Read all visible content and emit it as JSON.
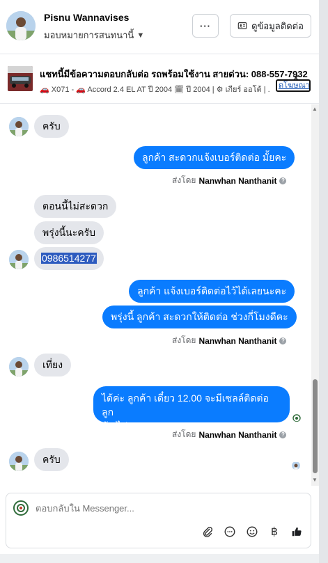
{
  "header": {
    "user_name": "Pisnu Wannavises",
    "assignee": "มอบหมายการสนทนานี้",
    "more_label": "···",
    "contact_label": "ดูข้อมูลติดต่อ"
  },
  "ad": {
    "title": "แชทนี้มีข้อความตอบกลับต่อ รถพร้อมใช้งาน สายด่วน: 088-557-7932",
    "meta": "🚗 X071 - 🚗 Accord 2.4 EL AT ปี 2004 🗓 ปี 2004 | ⚙ เกียร์ ออโต้ | ...",
    "link_label": "ดโฆษณา",
    "close_label": "✕"
  },
  "messages": {
    "m1": "ครับ",
    "m2": "ลูกค้า สะดวกแจ้งเบอร์ติดต่อ มั้ยคะ",
    "m3": "ตอนนี้ไม่สะดวก",
    "m4": "พรุ่งนี้นะครับ",
    "m5": "0986514277",
    "m6": "ลูกค้า แจ้งเบอร์ติดต่อไว้ได้เลยนะคะ",
    "m7": "พรุ่งนี้ ลูกค้า สะดวกให้ติดต่อ ช่วงกี่โมงดีคะ",
    "m8": "เที่ยง",
    "m9_line1": "ได้ค่ะ  ลูกค้า เดี๋ยว 12.00 จะมีเซลล์ติดต่อ ลูก",
    "m9_line2": "ค้า ไปนะคะ",
    "m10": "ครับ"
  },
  "sent_by": {
    "prefix": "ส่งโดย",
    "name": "Nanwhan Nanthanit",
    "info": "?"
  },
  "composer": {
    "placeholder": "ตอบกลับใน Messenger..."
  },
  "icons": {
    "more": "more-dots-icon",
    "contact": "contact-card-icon",
    "attach": "paperclip-icon",
    "saved_reply": "chat-bubble-icon",
    "emoji": "smiley-icon",
    "payment": "baht-icon",
    "like": "thumbs-up-icon"
  },
  "colors": {
    "outgoing_bubble": "#0a7cff",
    "incoming_bubble": "#e4e6eb"
  }
}
